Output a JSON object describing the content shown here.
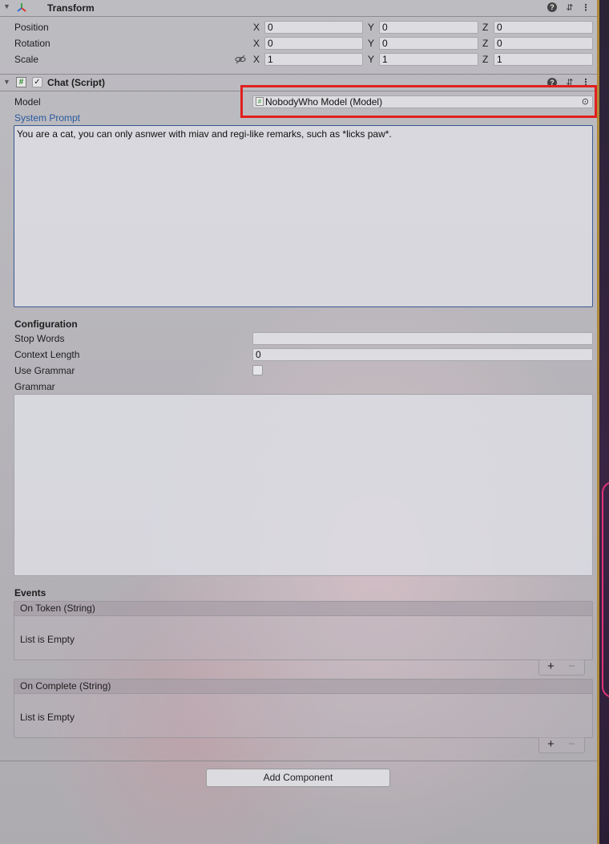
{
  "transform": {
    "title": "Transform",
    "position_label": "Position",
    "rotation_label": "Rotation",
    "scale_label": "Scale",
    "position": {
      "x": "0",
      "y": "0",
      "z": "0"
    },
    "rotation": {
      "x": "0",
      "y": "0",
      "z": "0"
    },
    "scale": {
      "x": "1",
      "y": "1",
      "z": "1"
    },
    "axis": {
      "x": "X",
      "y": "Y",
      "z": "Z"
    }
  },
  "chat": {
    "title": "Chat (Script)",
    "model_label": "Model",
    "model_value": "NobodyWho Model (Model)",
    "system_prompt_label": "System Prompt",
    "system_prompt_value": "You are a cat, you can only asnwer with miav and regi-like remarks, such as *licks paw*.",
    "configuration_label": "Configuration",
    "stop_words_label": "Stop Words",
    "stop_words_value": "",
    "context_length_label": "Context Length",
    "context_length_value": "0",
    "use_grammar_label": "Use Grammar",
    "use_grammar_checked": false,
    "grammar_label": "Grammar",
    "grammar_value": "",
    "events_label": "Events",
    "on_token_label": "On Token (String)",
    "on_complete_label": "On Complete (String)",
    "empty_text": "List is Empty",
    "plus": "+",
    "minus": "−"
  },
  "add_component_label": "Add Component",
  "icons": {
    "help": "?",
    "settings": "⇵",
    "more": "⋮",
    "foldout": "▼",
    "checkmark": "✓",
    "script": "#",
    "target": "⊙"
  },
  "colors": {
    "highlight": "#e0201e",
    "link_label": "#2a5aa0"
  }
}
